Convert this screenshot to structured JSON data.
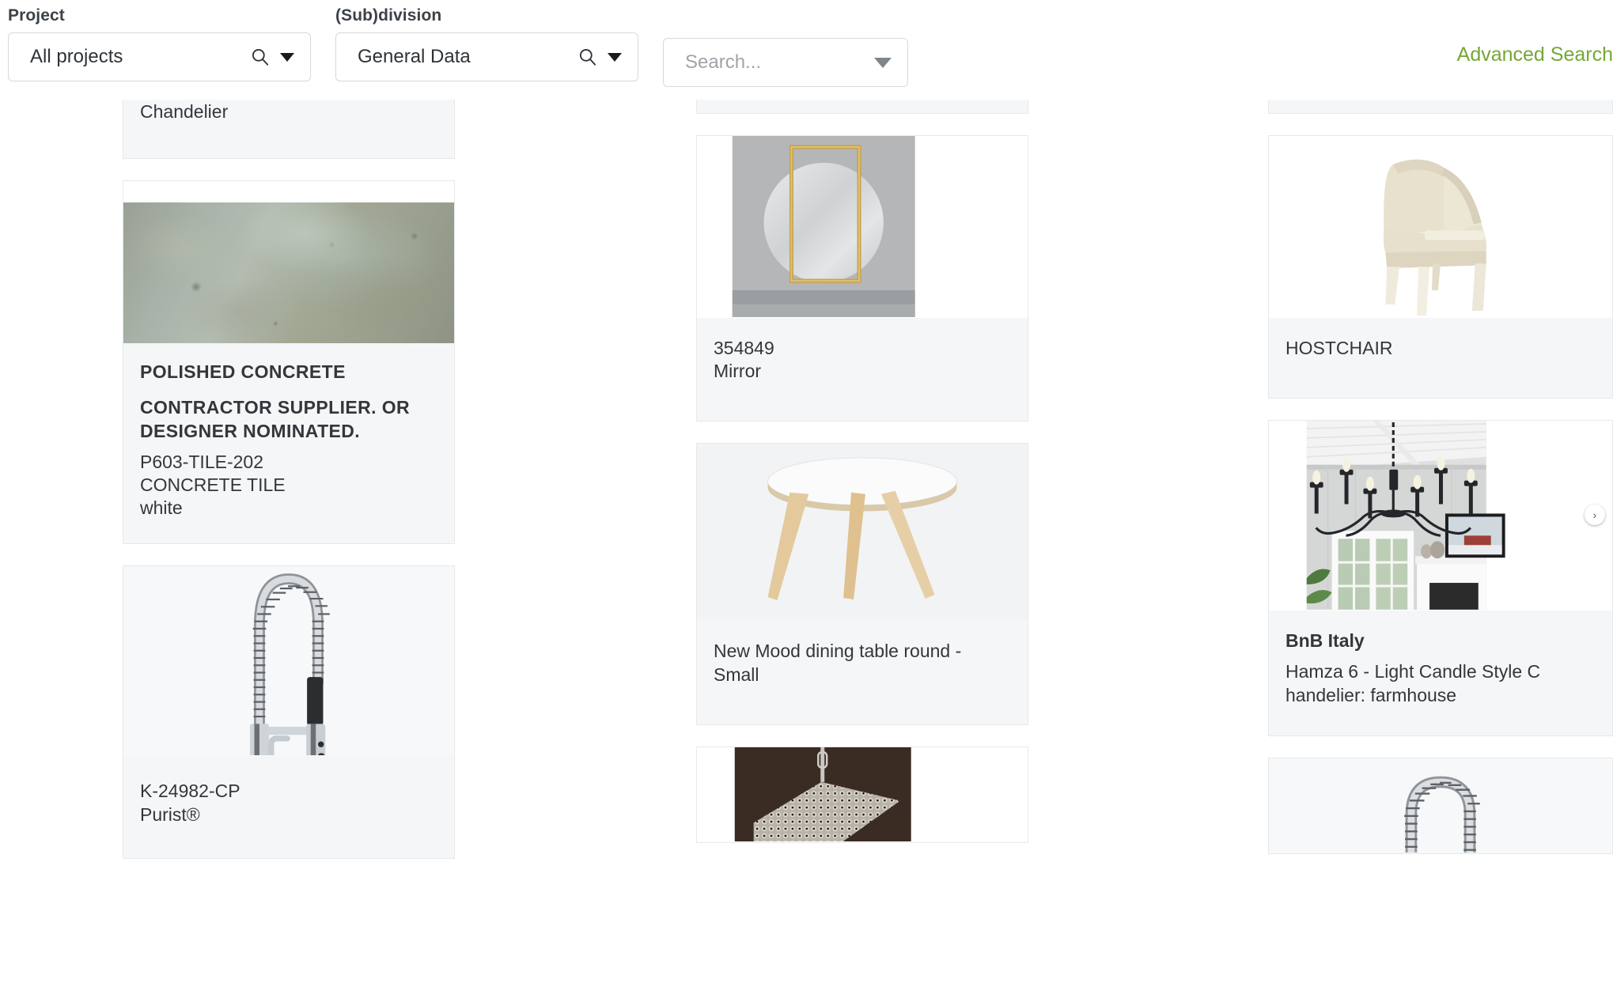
{
  "filters": {
    "project": {
      "label": "Project",
      "value": "All projects",
      "search_icon": "search-icon",
      "caret_icon": "chevron-down-icon"
    },
    "division": {
      "label": "(Sub)division",
      "value": "General Data",
      "search_icon": "search-icon",
      "caret_icon": "chevron-down-icon"
    },
    "search": {
      "placeholder": "Search...",
      "value": "",
      "caret_icon": "chevron-down-icon"
    },
    "advanced_search_label": "Advanced Search",
    "accent_color": "#76a736"
  },
  "board": {
    "columns": [
      {
        "id": "col1",
        "cards": [
          {
            "name": "chandelier-partial-card",
            "clipped_top": true,
            "lines": [
              "Chandelier"
            ]
          },
          {
            "name": "polished-concrete-card",
            "image": "concrete-texture",
            "title": "POLISHED CONCRETE",
            "subtitle": "CONTRACTOR SUPPLIER. OR DESIGNER NOMINATED.",
            "lines": [
              "P603-TILE-202",
              "CONCRETE TILE",
              "white"
            ]
          },
          {
            "name": "purist-faucet-card",
            "image": "kitchen-faucet",
            "lines": [
              "K-24982-CP",
              "Purist®"
            ]
          }
        ]
      },
      {
        "id": "col2",
        "cards": [
          {
            "name": "clipped-card-top",
            "clipped_top": true,
            "lines": []
          },
          {
            "name": "mirror-card",
            "image": "round-gold-mirror",
            "lines": [
              "354849",
              "Mirror"
            ]
          },
          {
            "name": "dining-table-card",
            "image": "round-dining-table",
            "lines": [
              "New Mood dining table round - Small"
            ]
          },
          {
            "name": "crystal-pendant-card",
            "image": "crystal-square-pendant",
            "clipped_bottom": true,
            "lines": []
          }
        ]
      },
      {
        "id": "col3",
        "cards": [
          {
            "name": "clipped-card-top",
            "clipped_top": true,
            "lines": []
          },
          {
            "name": "hostchair-card",
            "image": "cream-host-chair",
            "lines": [
              "HOSTCHAIR"
            ]
          },
          {
            "name": "bnb-italy-chandelier-card",
            "image": "farmhouse-chandelier",
            "title": "BnB Italy",
            "lines": [
              "Hamza 6 - Light Candle Style C handelier: farmhouse"
            ],
            "next_icon": "chevron-right-icon"
          },
          {
            "name": "faucet-card-bottom",
            "image": "kitchen-faucet",
            "clipped_bottom": true,
            "lines": []
          }
        ]
      }
    ]
  }
}
